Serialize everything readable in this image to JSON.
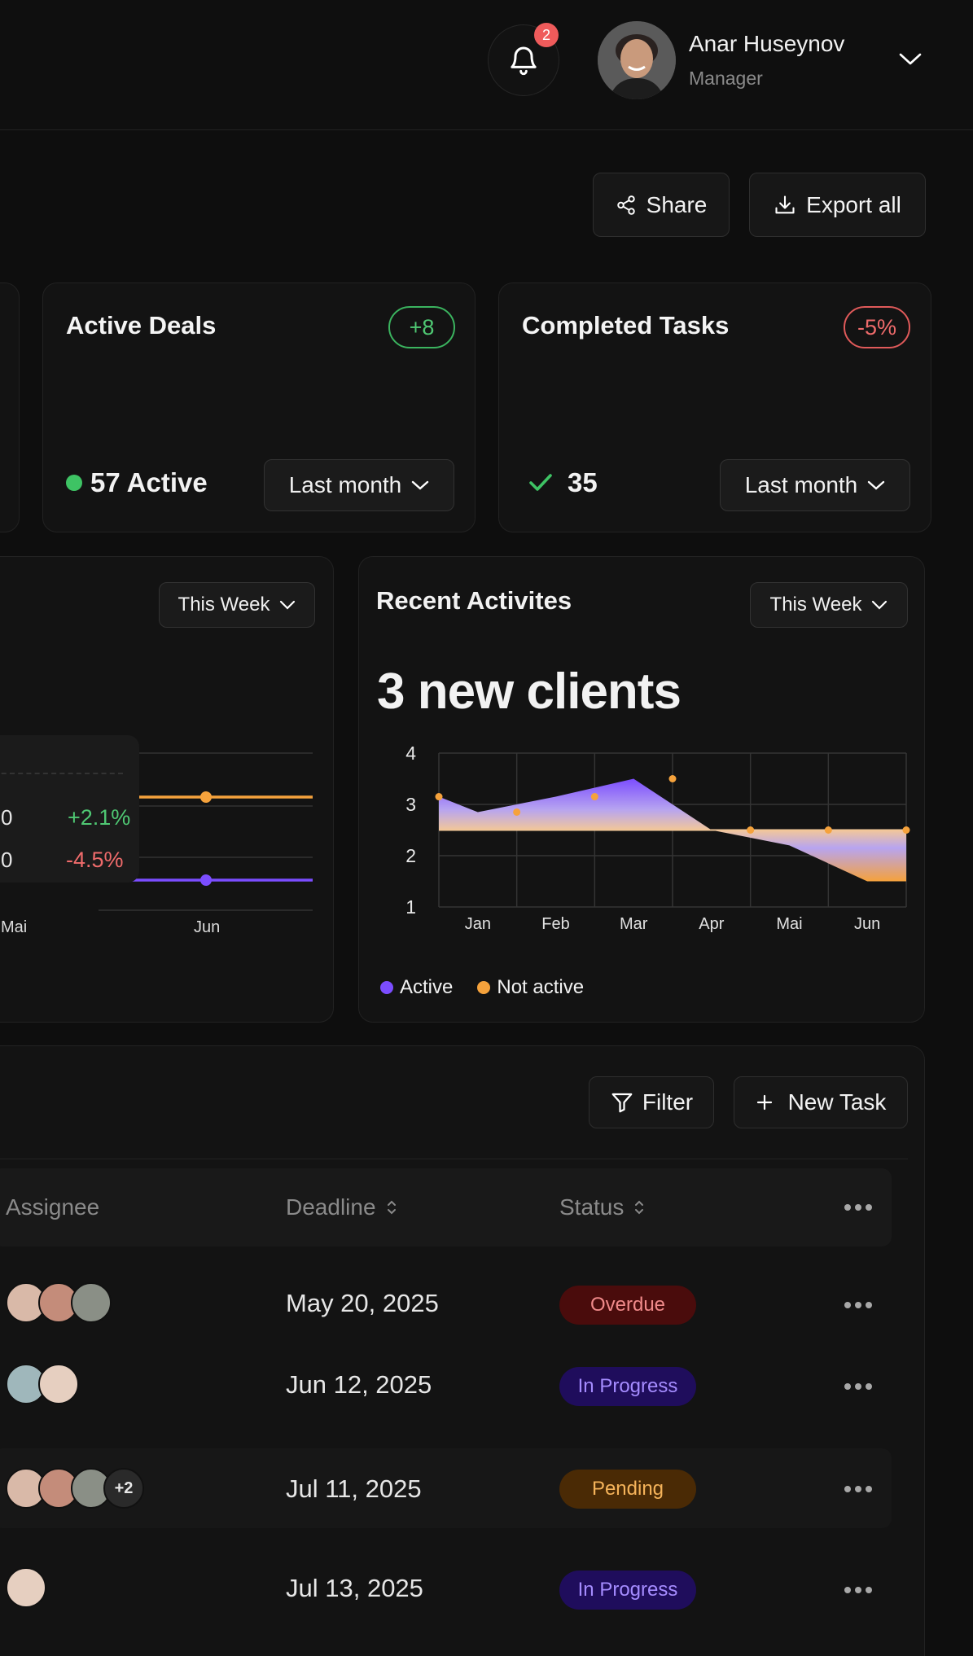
{
  "header": {
    "notifications_count": "2",
    "user_name": "Anar Huseynov",
    "user_role": "Manager",
    "bell_icon": "bell-icon",
    "chevron_icon": "chevron-down-icon"
  },
  "toolbar": {
    "share_label": "Share",
    "export_label": "Export all"
  },
  "cards": {
    "active_deals": {
      "title": "Active Deals",
      "change": "+8",
      "value": "57 Active",
      "period": "Last month"
    },
    "completed_tasks": {
      "title": "Completed Tasks",
      "change": "-5%",
      "value": "35",
      "period": "Last month"
    }
  },
  "left_chart": {
    "period": "This Week",
    "tooltip_rows": [
      {
        "value": "0",
        "change": "+2.1%"
      },
      {
        "value": "0",
        "change": "-4.5%"
      }
    ],
    "x_labels": [
      "Mai",
      "Jun"
    ]
  },
  "recent": {
    "title": "Recent Activites",
    "period": "This Week",
    "headline": "3 new clients",
    "legend_active": "Active",
    "legend_inactive": "Not active"
  },
  "chart_data": {
    "type": "area",
    "categories": [
      "Jan",
      "Feb",
      "Mar",
      "Apr",
      "Mai",
      "Jun"
    ],
    "y_ticks": [
      "4",
      "3",
      "2",
      "1"
    ],
    "ylim": [
      1,
      4
    ],
    "x_points": [
      0,
      0.5,
      1.5,
      2.5,
      3.5,
      4.5,
      5.5,
      6
    ],
    "series": [
      {
        "name": "Active",
        "color": "#7b4dff",
        "values": [
          3.15,
          2.85,
          3.15,
          3.5,
          2.5,
          2.2,
          1.5,
          1.5
        ]
      },
      {
        "name": "Not active",
        "color": "#f5a23c",
        "values": [
          2.5,
          2.5,
          2.5,
          2.5,
          2.5,
          2.5,
          2.5,
          2.5
        ]
      }
    ],
    "markers_active": [
      [
        0,
        3.15
      ],
      [
        1,
        2.85
      ],
      [
        2,
        3.15
      ],
      [
        3,
        3.5
      ]
    ],
    "markers_inactive": [
      [
        4,
        2.5
      ],
      [
        5,
        2.5
      ],
      [
        6,
        2.5
      ]
    ],
    "grid": true
  },
  "tasks": {
    "filter_label": "Filter",
    "new_task_label": "New Task",
    "columns": {
      "assignee": "Assignee",
      "deadline": "Deadline",
      "status": "Status"
    },
    "rows": [
      {
        "deadline": "May 20, 2025",
        "status": "Overdue",
        "avatars": 3,
        "more": ""
      },
      {
        "deadline": "Jun 12, 2025",
        "status": "In Progress",
        "avatars": 2,
        "more": ""
      },
      {
        "deadline": "Jul 11, 2025",
        "status": "Pending",
        "avatars": 3,
        "more": "+2"
      },
      {
        "deadline": "Jul 13, 2025",
        "status": "In Progress",
        "avatars": 1,
        "more": ""
      }
    ]
  },
  "colors": {
    "positive": "#4fc873",
    "negative": "#ef6b6b",
    "accent_purple": "#7b4dff",
    "accent_orange": "#f5a23c"
  }
}
